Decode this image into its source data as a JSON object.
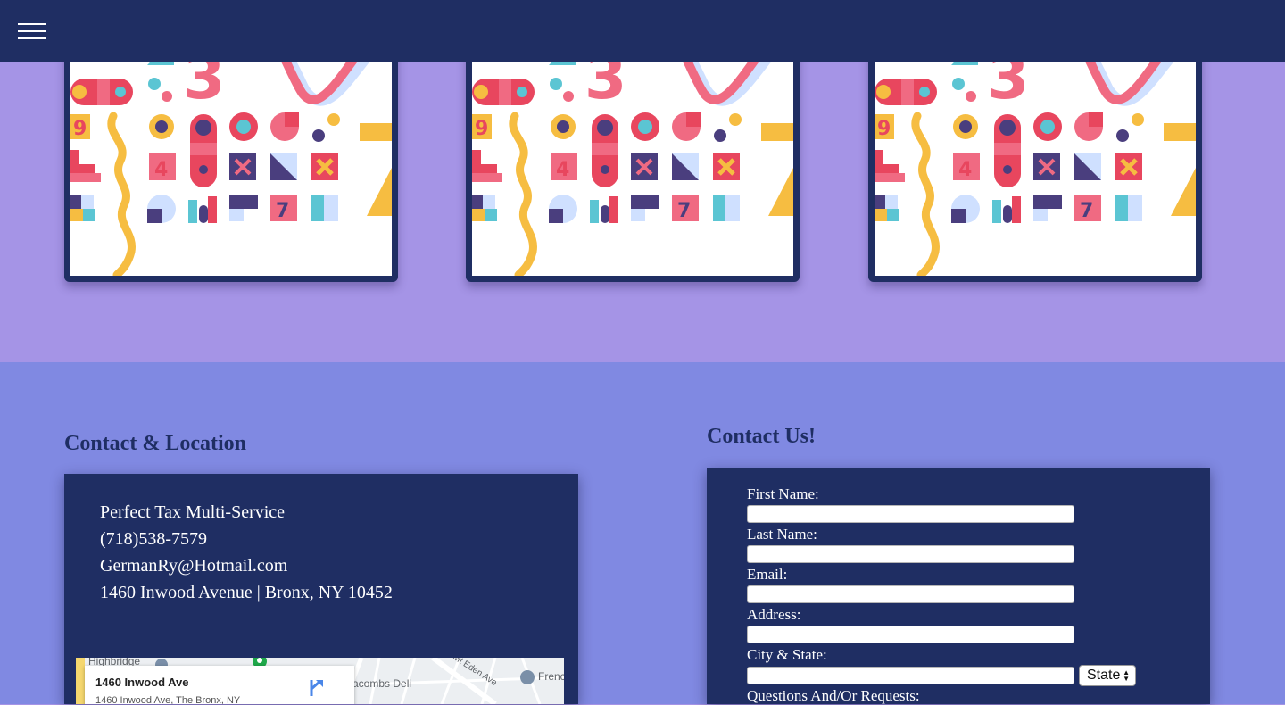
{
  "nav": {
    "menu_icon": "hamburger-menu-icon"
  },
  "gallery": {
    "cards": [
      {
        "image": "colorful-geometric-number-pattern"
      },
      {
        "image": "colorful-geometric-number-pattern"
      },
      {
        "image": "colorful-geometric-number-pattern"
      }
    ],
    "pattern_digits": [
      "3",
      "9",
      "4",
      "7"
    ]
  },
  "location": {
    "heading": "Contact & Location",
    "business_name": "Perfect Tax Multi-Service",
    "phone": "(718)538-7579",
    "email": "GermanRy@Hotmail.com",
    "address": "1460 Inwood Avenue | Bronx, NY 10452",
    "map": {
      "place_title": "1460 Inwood Ave",
      "place_address": "1460 Inwood Ave, The Bronx, NY",
      "labels": [
        "Highbridge",
        "acombs Deli",
        "E Mt Eden Ave",
        "Frenc"
      ],
      "directions_icon": "directions-icon"
    }
  },
  "form": {
    "heading": "Contact Us!",
    "fields": {
      "first_name": "First Name:",
      "last_name": "Last Name:",
      "email": "Email:",
      "address": "Address:",
      "city_state": "City & State:",
      "questions": "Questions And/Or Requests:"
    },
    "state_select": {
      "selected": "State"
    }
  },
  "colors": {
    "navy": "#1f2e63",
    "lavender": "#a594e6",
    "periwinkle": "#8089e2",
    "pink": "#f06a82",
    "red": "#e8465e",
    "yellow": "#f6bd41",
    "teal": "#5bc5d3",
    "indigo": "#4a3e7e"
  }
}
